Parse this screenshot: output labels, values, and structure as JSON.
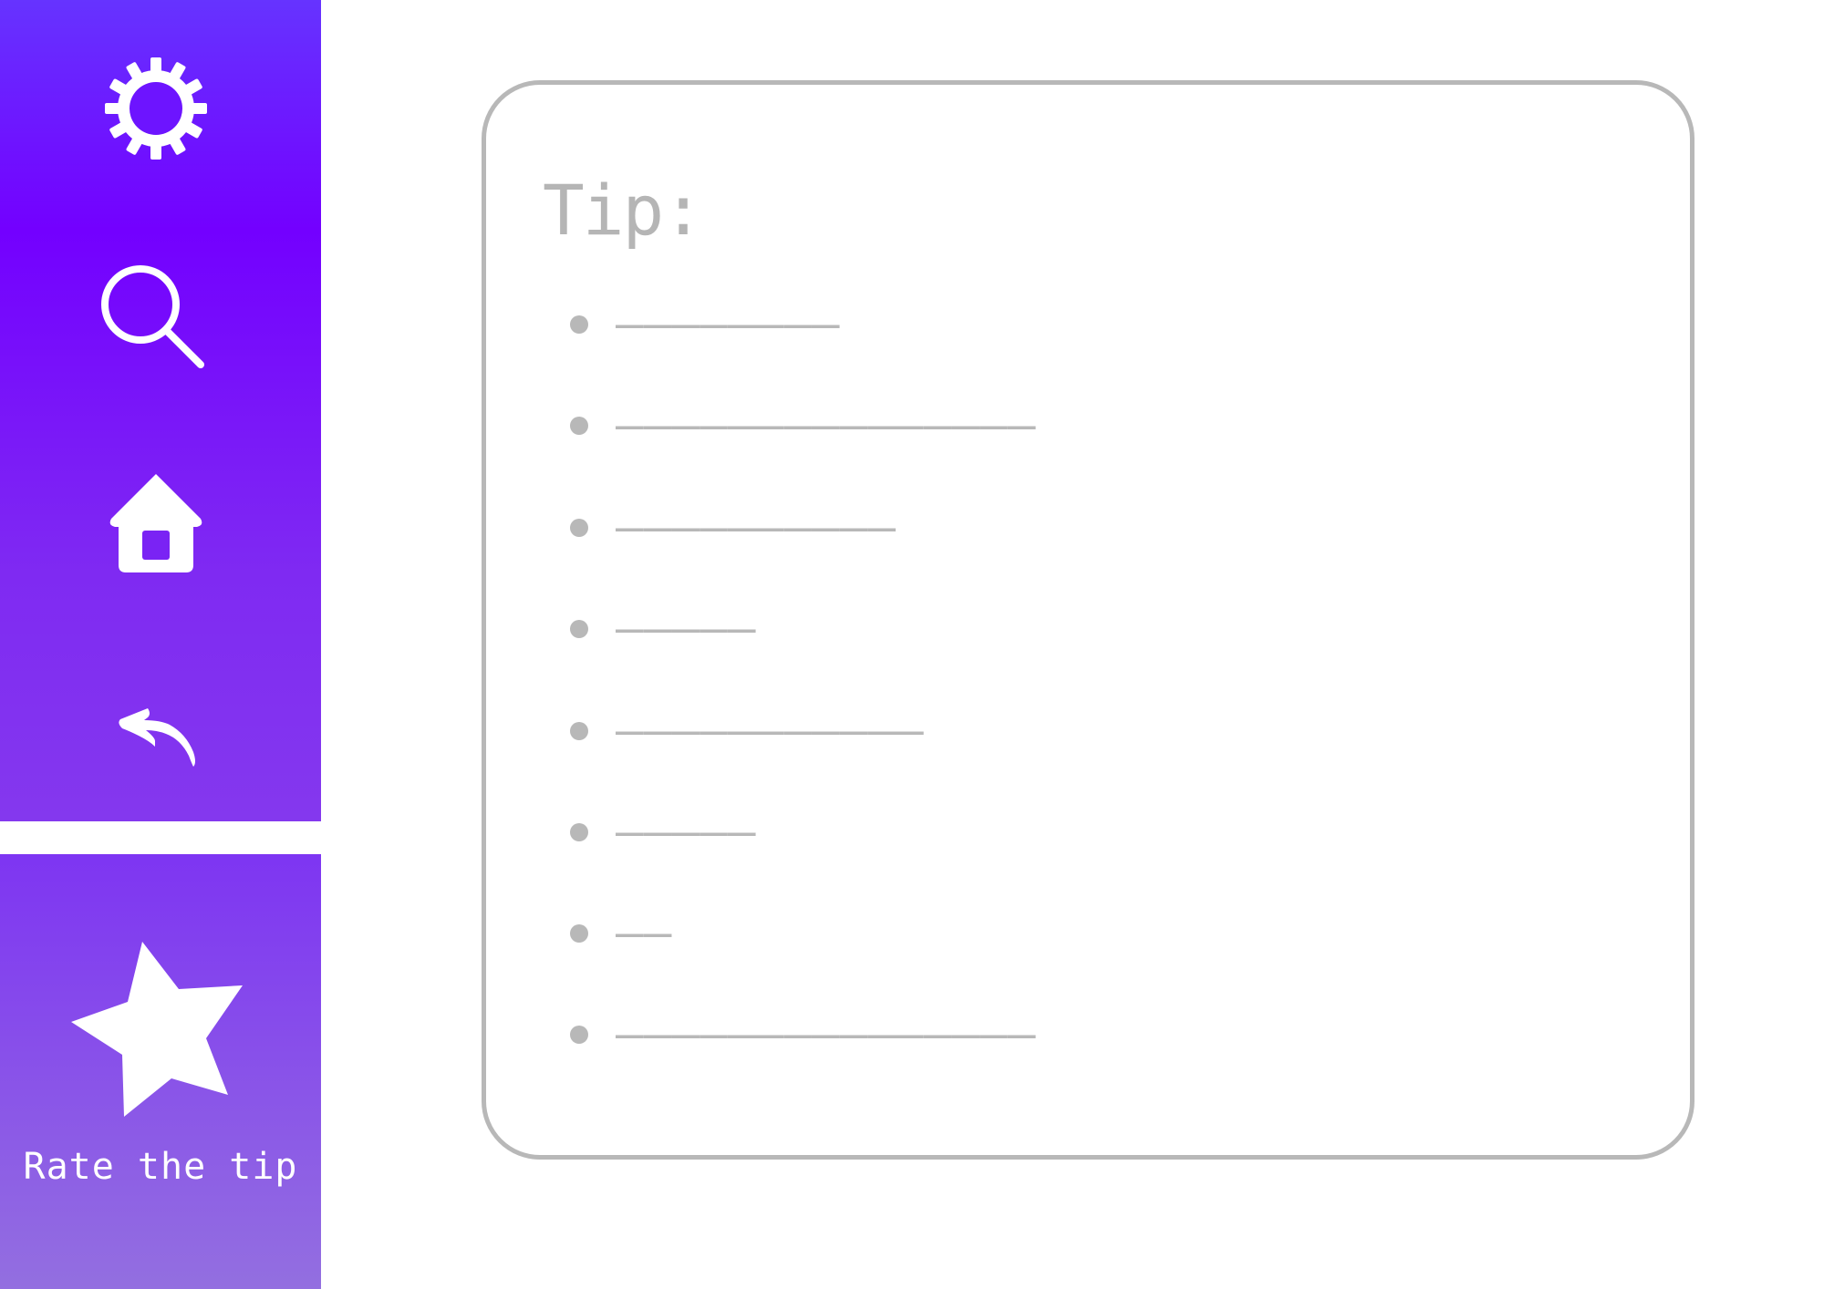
{
  "sidebar": {
    "items": [
      {
        "name": "settings",
        "icon": "gear-icon"
      },
      {
        "name": "search",
        "icon": "search-icon"
      },
      {
        "name": "home",
        "icon": "home-icon"
      },
      {
        "name": "back",
        "icon": "reply-arrow-icon"
      }
    ]
  },
  "rate": {
    "icon": "star-icon",
    "label": "Rate the tip"
  },
  "tip": {
    "title": "Tip:",
    "items": [
      {
        "text": "————————"
      },
      {
        "text": "———————————————"
      },
      {
        "text": "——————————"
      },
      {
        "text": "—————"
      },
      {
        "text": "———————————"
      },
      {
        "text": "—————"
      },
      {
        "text": "——"
      },
      {
        "text": "———————————————"
      }
    ]
  },
  "colors": {
    "sidebar_top": "#6633ff",
    "sidebar_mid": "#7300ff",
    "rate_panel": "#8a55e8",
    "placeholder_gray": "#b8b8b8",
    "icon_white": "#ffffff"
  }
}
